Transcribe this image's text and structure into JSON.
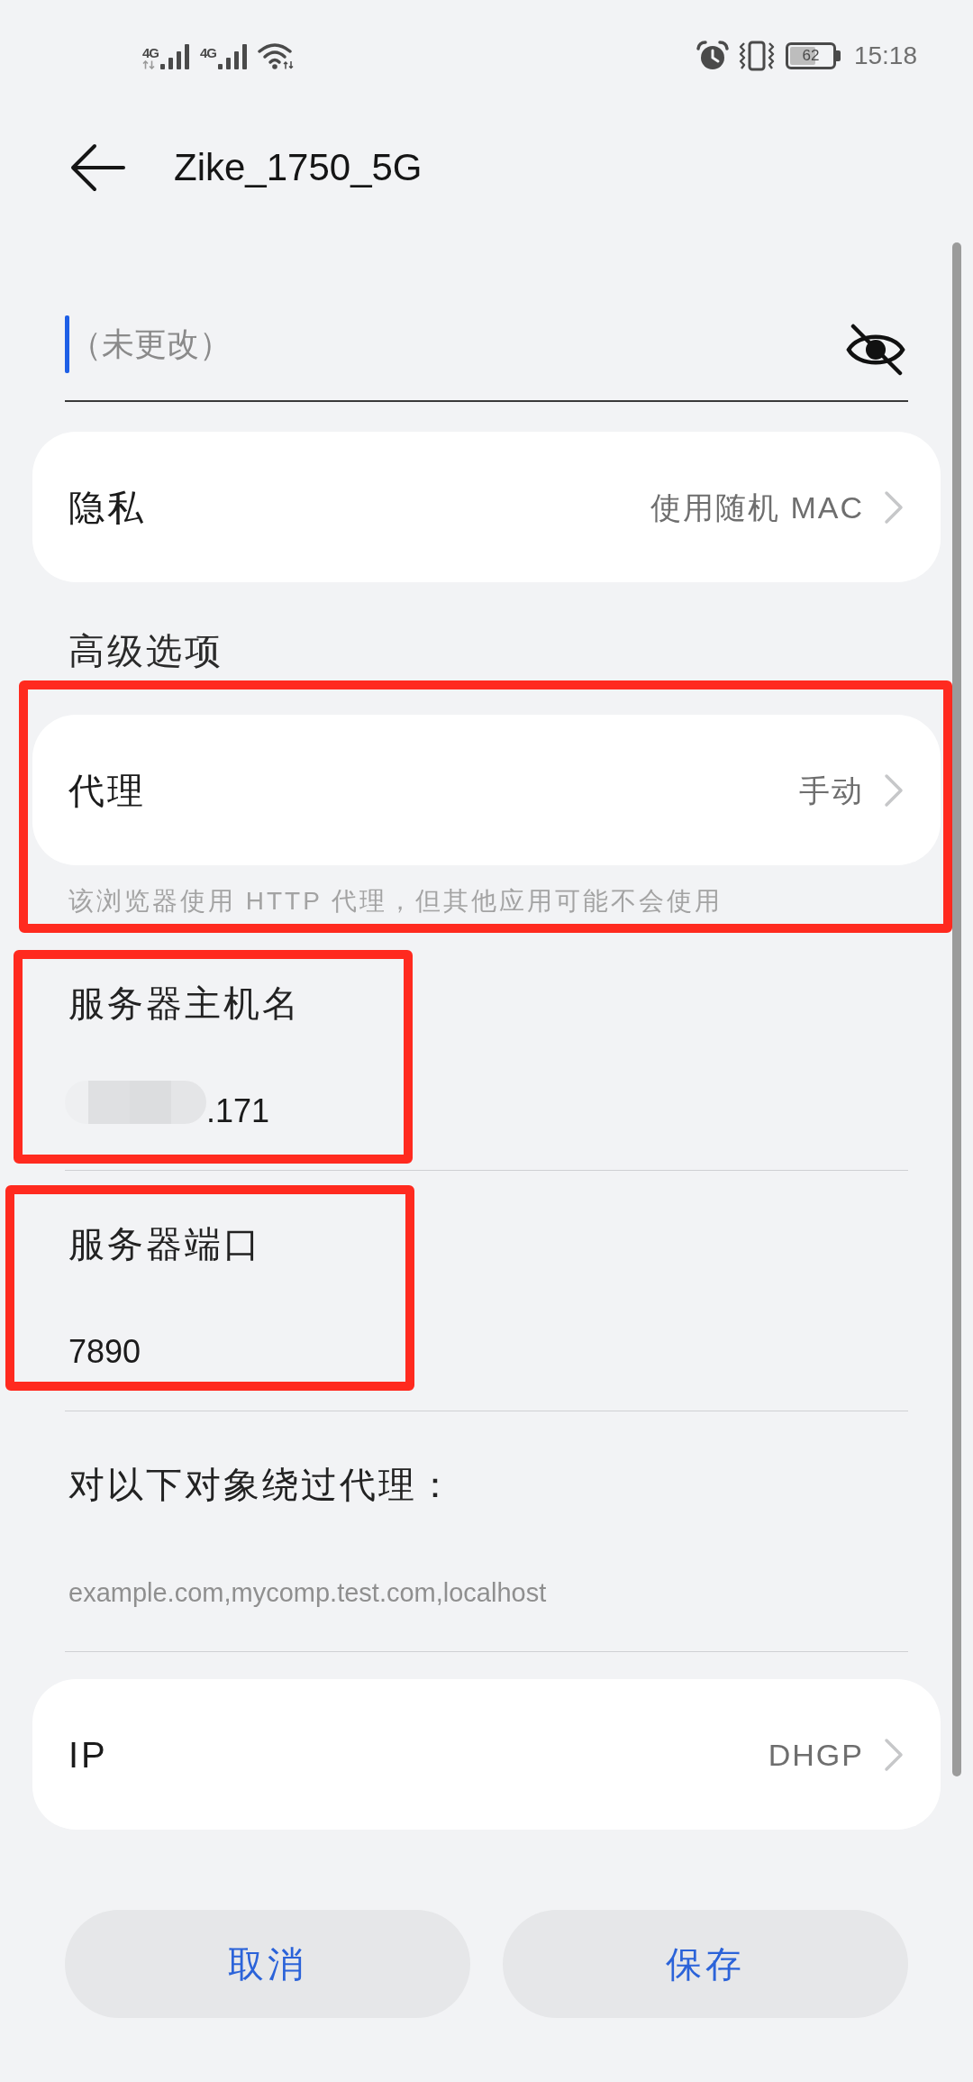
{
  "status_bar": {
    "signals": [
      {
        "network": "4G",
        "data_active": true
      },
      {
        "network": "4G",
        "data_active": false
      }
    ],
    "battery": "62",
    "time": "15:18"
  },
  "header": {
    "title": "Zike_1750_5G"
  },
  "password_field": {
    "placeholder": "（未更改）"
  },
  "privacy": {
    "label": "隐私",
    "value": "使用随机 MAC"
  },
  "advanced_options": {
    "title": "高级选项"
  },
  "proxy": {
    "label": "代理",
    "value": "手动",
    "hint": "该浏览器使用 HTTP 代理，但其他应用可能不会使用"
  },
  "proxy_fields": [
    {
      "label": "服务器主机名",
      "value": ".171",
      "redacted": true
    },
    {
      "label": "服务器端口",
      "value": "7890",
      "redacted": false
    },
    {
      "label": "对以下对象绕过代理：",
      "placeholder": "example.com,mycomp.test.com,localhost",
      "redacted": false
    }
  ],
  "ip": {
    "label": "IP",
    "value": "DHGP"
  },
  "buttons": [
    {
      "label": "取消"
    },
    {
      "label": "保存"
    }
  ]
}
